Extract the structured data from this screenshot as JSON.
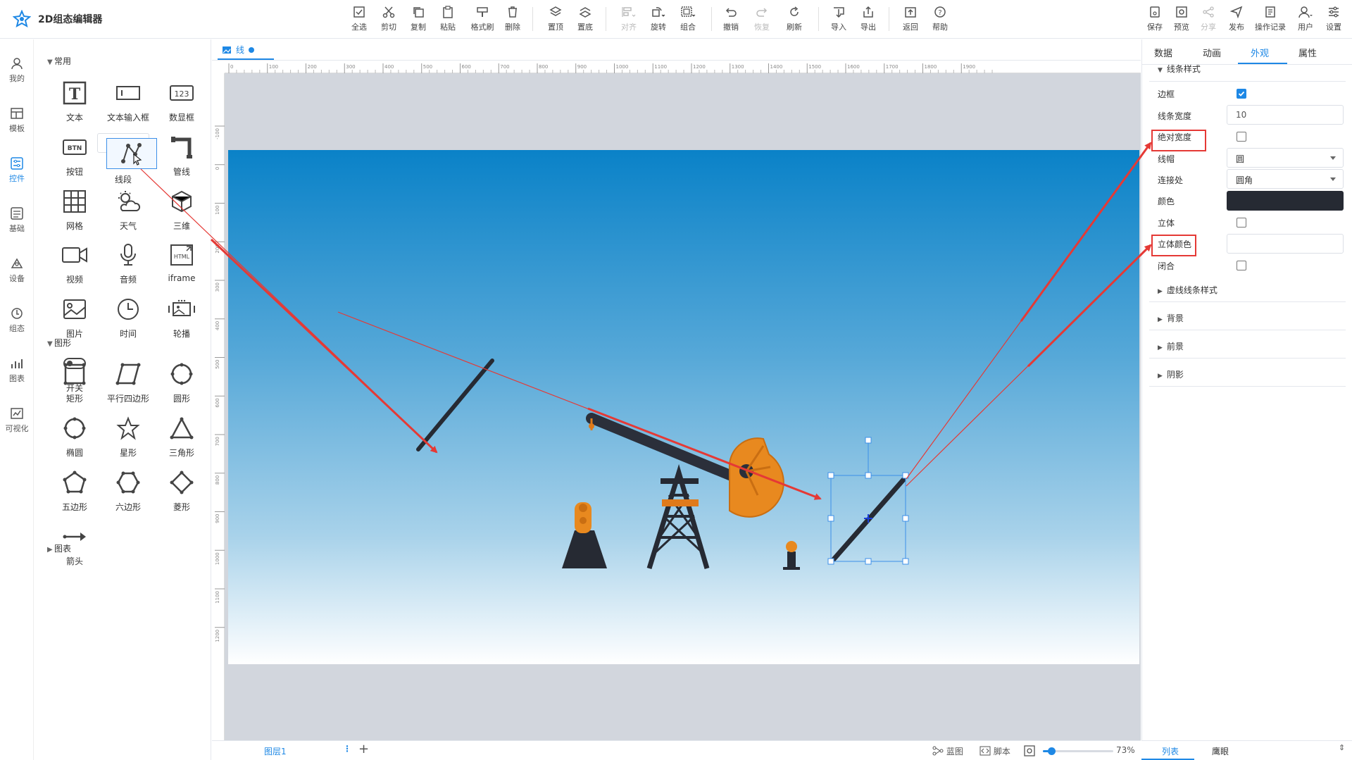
{
  "app": {
    "title": "2D组态编辑器"
  },
  "toolbar": {
    "select_all": "全选",
    "cut": "剪切",
    "copy": "复制",
    "paste": "粘贴",
    "format_brush": "格式刷",
    "delete": "删除",
    "bring_top": "置顶",
    "send_bottom": "置底",
    "align": "对齐",
    "rotate": "旋转",
    "group": "组合",
    "undo": "撤销",
    "redo": "恢复",
    "refresh": "刷新",
    "import": "导入",
    "export": "导出",
    "back": "返回",
    "help": "帮助",
    "save": "保存",
    "preview": "预览",
    "share": "分享",
    "publish": "发布",
    "history": "操作记录",
    "user": "用户",
    "settings": "设置"
  },
  "leftnav": {
    "mine": "我的",
    "template": "模板",
    "controls": "控件",
    "basic": "基础",
    "device": "设备",
    "config": "组态",
    "chart": "图表",
    "visual": "可视化"
  },
  "palette": {
    "common_header": "常用",
    "common": [
      "文本",
      "文本输入框",
      "数显框",
      "按钮",
      "线段",
      "管线",
      "网格",
      "天气",
      "三维",
      "视频",
      "音频",
      "iframe",
      "图片",
      "时间",
      "轮播",
      "开关"
    ],
    "shape_header": "图形",
    "shapes": [
      "矩形",
      "平行四边形",
      "圆形",
      "椭圆",
      "星形",
      "三角形",
      "五边形",
      "六边形",
      "菱形",
      "箭头"
    ],
    "chart_header": "图表"
  },
  "doc_tab": {
    "label": "线"
  },
  "ruler_h": [
    "0",
    "100",
    "200",
    "300",
    "400",
    "500",
    "600",
    "700",
    "800",
    "900",
    "1000",
    "1100",
    "1200",
    "1300",
    "1400",
    "1500",
    "1600",
    "1700",
    "1800",
    "1900"
  ],
  "ruler_v": [
    "-100",
    "0",
    "100",
    "200",
    "300",
    "400",
    "500",
    "600",
    "700",
    "800",
    "900",
    "1000",
    "1100",
    "1200"
  ],
  "props": {
    "tabs": [
      "数据",
      "动画",
      "外观",
      "属性"
    ],
    "active_tab": "外观",
    "line_style_header": "线条样式",
    "border_label": "边框",
    "border_checked": true,
    "width_label": "线条宽度",
    "width_value": "10",
    "abs_width_label": "绝对宽度",
    "cap_label": "线帽",
    "cap_value": "圆",
    "join_label": "连接处",
    "join_value": "圆角",
    "color_label": "颜色",
    "color_value": "#262a33",
    "solid_label": "立体",
    "solid_color_label": "立体颜色",
    "closed_label": "闭合",
    "dashed_header": "虚线线条样式",
    "bg_header": "背景",
    "fg_header": "前景",
    "shadow_header": "阴影"
  },
  "bottom": {
    "layer": "图层1",
    "blueprint": "蓝图",
    "script": "脚本",
    "zoom": "73%",
    "zoom_fraction": 0.12,
    "list_tab": "列表",
    "layer_tab": "鹰眼"
  },
  "colors": {
    "accent": "#1e88e5",
    "highlight": "#e53935",
    "line": "#262a33"
  }
}
